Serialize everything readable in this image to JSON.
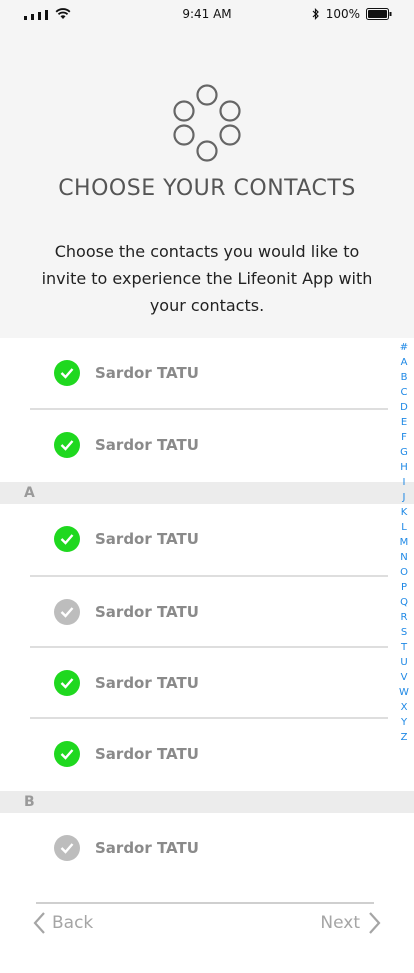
{
  "status": {
    "time": "9:41 AM",
    "battery": "100%"
  },
  "header": {
    "title": "CHOOSE YOUR CONTACTS",
    "subtitle": "Choose the contacts you would like to invite to experience the Lifeonit App with your contacts."
  },
  "contacts": [
    {
      "name": "Sardor TATU",
      "selected": true
    },
    {
      "name": "Sardor TATU",
      "selected": true
    },
    {
      "name": "Sardor TATU",
      "selected": true
    },
    {
      "name": "Sardor TATU",
      "selected": false
    },
    {
      "name": "Sardor TATU",
      "selected": true
    },
    {
      "name": "Sardor TATU",
      "selected": true
    },
    {
      "name": "Sardor TATU",
      "selected": false
    }
  ],
  "sections": {
    "a": "A",
    "b": "B"
  },
  "alphabet": [
    "#",
    "A",
    "B",
    "C",
    "D",
    "E",
    "F",
    "G",
    "H",
    "I",
    "J",
    "K",
    "L",
    "M",
    "N",
    "O",
    "P",
    "Q",
    "R",
    "S",
    "T",
    "U",
    "V",
    "W",
    "X",
    "Y",
    "Z"
  ],
  "footer": {
    "back_label": "Back",
    "next_label": "Next"
  },
  "colors": {
    "selected": "#1fd81f",
    "unselected": "#bdbdbd",
    "index": "#1e88e5"
  }
}
